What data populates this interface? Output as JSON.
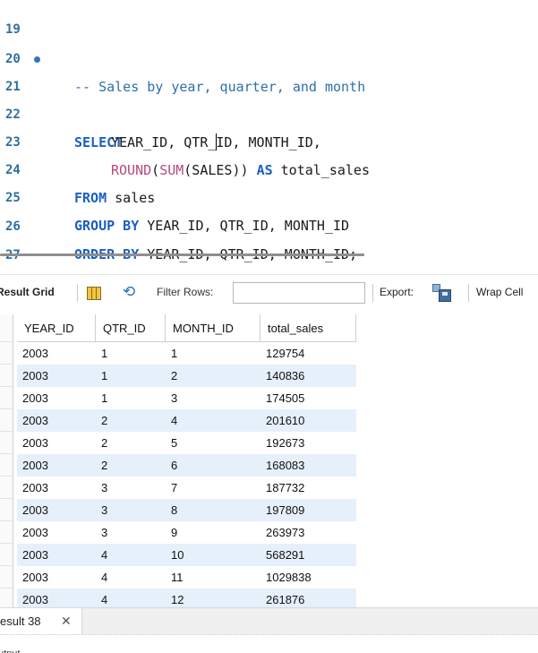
{
  "editor": {
    "lines": [
      {
        "num": "19"
      },
      {
        "num": "20",
        "comment": "-- Sales by year, quarter, and month"
      },
      {
        "num": "21",
        "kw": "SELECT"
      },
      {
        "num": "22",
        "text_a": "YEAR_ID, QTR_",
        "text_b": "ID, MONTH_ID,"
      },
      {
        "num": "23",
        "fn": "ROUND",
        "fn_open": "(",
        "fn2": "SUM",
        "fn2_arg": "(SALES))",
        "kw": "AS",
        "rest": "total_sales"
      },
      {
        "num": "24",
        "kw": "FROM",
        "rest": "sales"
      },
      {
        "num": "25",
        "kw": "GROUP BY",
        "rest": "YEAR_ID, QTR_ID, MONTH_ID"
      },
      {
        "num": "26",
        "kw": "ORDER BY",
        "rest": "YEAR_ID, QTR_ID, MONTH_ID;"
      },
      {
        "num": "27"
      }
    ]
  },
  "toolbar": {
    "result_grid": "Result Grid",
    "filter_rows": "Filter Rows:",
    "filter_value": "",
    "export": "Export:",
    "wrap_cell": "Wrap Cell"
  },
  "grid": {
    "columns": [
      "YEAR_ID",
      "QTR_ID",
      "MONTH_ID",
      "total_sales"
    ],
    "rows": [
      [
        "2003",
        "1",
        "1",
        "129754"
      ],
      [
        "2003",
        "1",
        "2",
        "140836"
      ],
      [
        "2003",
        "1",
        "3",
        "174505"
      ],
      [
        "2003",
        "2",
        "4",
        "201610"
      ],
      [
        "2003",
        "2",
        "5",
        "192673"
      ],
      [
        "2003",
        "2",
        "6",
        "168083"
      ],
      [
        "2003",
        "3",
        "7",
        "187732"
      ],
      [
        "2003",
        "3",
        "8",
        "197809"
      ],
      [
        "2003",
        "3",
        "9",
        "263973"
      ],
      [
        "2003",
        "4",
        "10",
        "568291"
      ],
      [
        "2003",
        "4",
        "11",
        "1029838"
      ],
      [
        "2003",
        "4",
        "12",
        "261876"
      ]
    ]
  },
  "tabs": {
    "result_tab": "esult 38",
    "close": "✕"
  },
  "output": {
    "label": "utput"
  },
  "colors": {
    "keyword": "#1b5fc4",
    "function": "#b7477d",
    "comment": "#2f6fa8",
    "alt_row": "#e6f0fb"
  }
}
